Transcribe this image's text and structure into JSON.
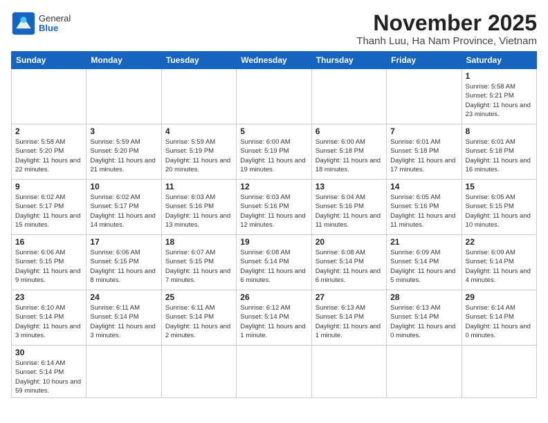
{
  "header": {
    "logo_general": "General",
    "logo_blue": "Blue",
    "month_title": "November 2025",
    "subtitle": "Thanh Luu, Ha Nam Province, Vietnam"
  },
  "weekdays": [
    "Sunday",
    "Monday",
    "Tuesday",
    "Wednesday",
    "Thursday",
    "Friday",
    "Saturday"
  ],
  "rows": [
    [
      {
        "day": "",
        "info": ""
      },
      {
        "day": "",
        "info": ""
      },
      {
        "day": "",
        "info": ""
      },
      {
        "day": "",
        "info": ""
      },
      {
        "day": "",
        "info": ""
      },
      {
        "day": "",
        "info": ""
      },
      {
        "day": "1",
        "info": "Sunrise: 5:58 AM\nSunset: 5:21 PM\nDaylight: 11 hours and 23 minutes."
      }
    ],
    [
      {
        "day": "2",
        "info": "Sunrise: 5:58 AM\nSunset: 5:20 PM\nDaylight: 11 hours and 22 minutes."
      },
      {
        "day": "3",
        "info": "Sunrise: 5:59 AM\nSunset: 5:20 PM\nDaylight: 11 hours and 21 minutes."
      },
      {
        "day": "4",
        "info": "Sunrise: 5:59 AM\nSunset: 5:19 PM\nDaylight: 11 hours and 20 minutes."
      },
      {
        "day": "5",
        "info": "Sunrise: 6:00 AM\nSunset: 5:19 PM\nDaylight: 11 hours and 19 minutes."
      },
      {
        "day": "6",
        "info": "Sunrise: 6:00 AM\nSunset: 5:18 PM\nDaylight: 11 hours and 18 minutes."
      },
      {
        "day": "7",
        "info": "Sunrise: 6:01 AM\nSunset: 5:18 PM\nDaylight: 11 hours and 17 minutes."
      },
      {
        "day": "8",
        "info": "Sunrise: 6:01 AM\nSunset: 5:18 PM\nDaylight: 11 hours and 16 minutes."
      }
    ],
    [
      {
        "day": "9",
        "info": "Sunrise: 6:02 AM\nSunset: 5:17 PM\nDaylight: 11 hours and 15 minutes."
      },
      {
        "day": "10",
        "info": "Sunrise: 6:02 AM\nSunset: 5:17 PM\nDaylight: 11 hours and 14 minutes."
      },
      {
        "day": "11",
        "info": "Sunrise: 6:03 AM\nSunset: 5:16 PM\nDaylight: 11 hours and 13 minutes."
      },
      {
        "day": "12",
        "info": "Sunrise: 6:03 AM\nSunset: 5:16 PM\nDaylight: 11 hours and 12 minutes."
      },
      {
        "day": "13",
        "info": "Sunrise: 6:04 AM\nSunset: 5:16 PM\nDaylight: 11 hours and 11 minutes."
      },
      {
        "day": "14",
        "info": "Sunrise: 6:05 AM\nSunset: 5:16 PM\nDaylight: 11 hours and 11 minutes."
      },
      {
        "day": "15",
        "info": "Sunrise: 6:05 AM\nSunset: 5:15 PM\nDaylight: 11 hours and 10 minutes."
      }
    ],
    [
      {
        "day": "16",
        "info": "Sunrise: 6:06 AM\nSunset: 5:15 PM\nDaylight: 11 hours and 9 minutes."
      },
      {
        "day": "17",
        "info": "Sunrise: 6:06 AM\nSunset: 5:15 PM\nDaylight: 11 hours and 8 minutes."
      },
      {
        "day": "18",
        "info": "Sunrise: 6:07 AM\nSunset: 5:15 PM\nDaylight: 11 hours and 7 minutes."
      },
      {
        "day": "19",
        "info": "Sunrise: 6:08 AM\nSunset: 5:14 PM\nDaylight: 11 hours and 6 minutes."
      },
      {
        "day": "20",
        "info": "Sunrise: 6:08 AM\nSunset: 5:14 PM\nDaylight: 11 hours and 6 minutes."
      },
      {
        "day": "21",
        "info": "Sunrise: 6:09 AM\nSunset: 5:14 PM\nDaylight: 11 hours and 5 minutes."
      },
      {
        "day": "22",
        "info": "Sunrise: 6:09 AM\nSunset: 5:14 PM\nDaylight: 11 hours and 4 minutes."
      }
    ],
    [
      {
        "day": "23",
        "info": "Sunrise: 6:10 AM\nSunset: 5:14 PM\nDaylight: 11 hours and 3 minutes."
      },
      {
        "day": "24",
        "info": "Sunrise: 6:11 AM\nSunset: 5:14 PM\nDaylight: 11 hours and 3 minutes."
      },
      {
        "day": "25",
        "info": "Sunrise: 6:11 AM\nSunset: 5:14 PM\nDaylight: 11 hours and 2 minutes."
      },
      {
        "day": "26",
        "info": "Sunrise: 6:12 AM\nSunset: 5:14 PM\nDaylight: 11 hours and 1 minute."
      },
      {
        "day": "27",
        "info": "Sunrise: 6:13 AM\nSunset: 5:14 PM\nDaylight: 11 hours and 1 minute."
      },
      {
        "day": "28",
        "info": "Sunrise: 6:13 AM\nSunset: 5:14 PM\nDaylight: 11 hours and 0 minutes."
      },
      {
        "day": "29",
        "info": "Sunrise: 6:14 AM\nSunset: 5:14 PM\nDaylight: 11 hours and 0 minutes."
      }
    ],
    [
      {
        "day": "30",
        "info": "Sunrise: 6:14 AM\nSunset: 5:14 PM\nDaylight: 10 hours and 59 minutes."
      },
      {
        "day": "",
        "info": ""
      },
      {
        "day": "",
        "info": ""
      },
      {
        "day": "",
        "info": ""
      },
      {
        "day": "",
        "info": ""
      },
      {
        "day": "",
        "info": ""
      },
      {
        "day": "",
        "info": ""
      }
    ]
  ]
}
